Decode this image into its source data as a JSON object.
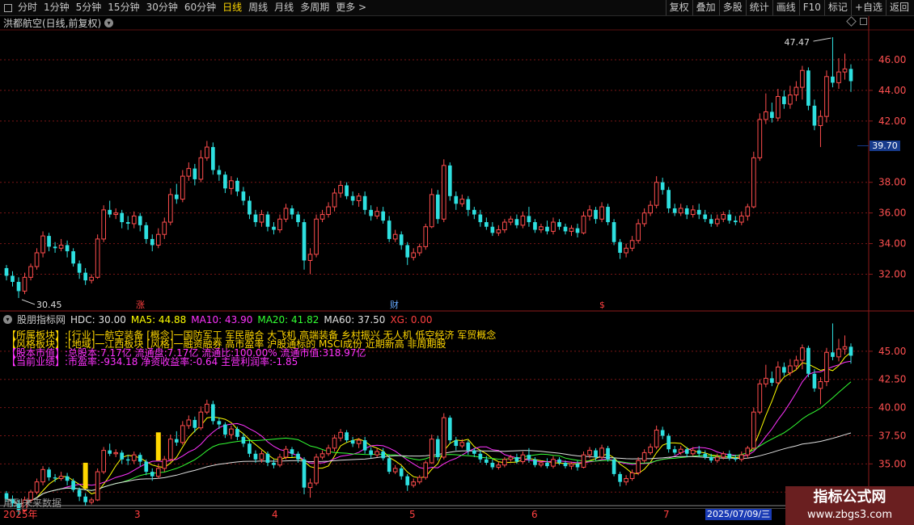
{
  "toolbar": {
    "periods": [
      "分时",
      "1分钟",
      "5分钟",
      "15分钟",
      "30分钟",
      "60分钟",
      "日线",
      "周线",
      "月线",
      "多周期",
      "更多 >"
    ],
    "active_period": "日线",
    "right_buttons": [
      "复权",
      "叠加",
      "多股",
      "统计",
      "画线",
      "F10",
      "标记",
      "+自选",
      "返回"
    ]
  },
  "main_chart": {
    "title": "洪都航空(日线,前复权)",
    "yaxis_ticks": [
      "46.00",
      "44.00",
      "42.00",
      "38.00",
      "36.00",
      "34.00",
      "32.00"
    ],
    "high_label": "47.47",
    "low_label": "30.45",
    "current_price": "39.70",
    "badges": {
      "zhang": "涨",
      "cai": "财",
      "s": "$"
    },
    "colors": {
      "up": "#ff4d4d",
      "down": "#2ee0e0",
      "grid": "#7a1616",
      "axis": "#8b1a1a"
    }
  },
  "indicator": {
    "title": "股朋指标网",
    "values": {
      "hdc": "HDC: 30.00",
      "ma5": "MA5: 44.88",
      "ma10": "MA10: 43.90",
      "ma20": "MA20: 41.82",
      "ma60": "MA60: 37.50",
      "xg": "XG: 0.00"
    },
    "info_rows": [
      {
        "label": "【所属板块】:",
        "text": "[行业]一航空装备 [概念]一国防军工 军民融合 大飞机 高端装备 乡村振兴 无人机 低空经济 军贸概念"
      },
      {
        "label": "【风格板块】:",
        "text": "[地域]一江西板块 [风格]一融资融券 高市盈率 沪股通标的 MSCI成份 近期新高 非周期股"
      },
      {
        "label": "【股本市值】:",
        "text": "总股本:7.17亿 流通盘:7.17亿 流通比:100.00% 流通市值:318.97亿"
      },
      {
        "label": "【当前业绩】:",
        "text": "市盈率:-934.18 净资收益率:-0.64 主营利润率:-1.85"
      }
    ],
    "yaxis_ticks": [
      "45.00",
      "42.50",
      "40.00",
      "37.50",
      "35.00",
      "32.50"
    ],
    "ghost_text": "用到未来数据"
  },
  "date_axis": {
    "labels": [
      "2025年",
      "3",
      "4",
      "5",
      "6",
      "7"
    ],
    "cursor_date": "2025/07/09/三"
  },
  "watermark": {
    "line1": "指标公式网",
    "line2": "www.zbgs3.com"
  },
  "chart_data": {
    "type": "candlestick",
    "ylim_main": [
      30.5,
      48.0
    ],
    "ylim_indicator": [
      32.3,
      47.5
    ],
    "candles": [
      [
        32.4,
        31.9,
        32.6,
        31.6
      ],
      [
        31.9,
        31.5,
        32.2,
        31.2
      ],
      [
        31.5,
        30.9,
        31.8,
        30.45
      ],
      [
        30.9,
        31.8,
        32.1,
        30.7
      ],
      [
        31.8,
        32.5,
        32.7,
        31.6
      ],
      [
        32.5,
        33.4,
        33.7,
        32.3
      ],
      [
        33.4,
        34.5,
        34.8,
        33.1
      ],
      [
        34.5,
        33.8,
        34.7,
        33.5
      ],
      [
        33.8,
        33.7,
        34.1,
        33.4
      ],
      [
        33.7,
        33.9,
        34.3,
        33.5
      ],
      [
        33.9,
        33.5,
        34.2,
        33.1
      ],
      [
        33.5,
        32.7,
        33.7,
        32.5
      ],
      [
        32.7,
        32.1,
        32.9,
        31.7
      ],
      [
        32.1,
        31.6,
        32.4,
        31.3
      ],
      [
        31.6,
        31.8,
        32.0,
        31.4
      ],
      [
        31.8,
        34.3,
        34.6,
        31.7
      ],
      [
        34.3,
        36.2,
        36.5,
        34.1
      ],
      [
        36.2,
        35.9,
        36.8,
        35.7
      ],
      [
        35.9,
        36.0,
        36.3,
        35.6
      ],
      [
        36.0,
        35.4,
        36.2,
        35.0
      ],
      [
        35.4,
        35.3,
        35.8,
        34.9
      ],
      [
        35.3,
        35.8,
        36.1,
        35.0
      ],
      [
        35.8,
        35.2,
        36.0,
        34.8
      ],
      [
        35.2,
        34.3,
        35.4,
        34.0
      ],
      [
        34.3,
        33.9,
        34.6,
        33.5
      ],
      [
        33.9,
        34.6,
        35.0,
        33.7
      ],
      [
        34.6,
        35.4,
        35.7,
        34.3
      ],
      [
        35.4,
        37.2,
        37.6,
        35.2
      ],
      [
        37.2,
        36.9,
        37.9,
        36.6
      ],
      [
        36.9,
        38.4,
        38.8,
        36.7
      ],
      [
        38.4,
        38.9,
        39.3,
        38.1
      ],
      [
        38.9,
        38.2,
        39.2,
        37.8
      ],
      [
        38.2,
        39.6,
        40.1,
        38.0
      ],
      [
        39.6,
        40.3,
        40.7,
        39.4
      ],
      [
        40.3,
        38.8,
        40.6,
        38.5
      ],
      [
        38.8,
        38.5,
        39.1,
        38.1
      ],
      [
        38.5,
        37.6,
        38.7,
        37.3
      ],
      [
        37.6,
        38.1,
        38.4,
        37.2
      ],
      [
        38.1,
        37.4,
        38.3,
        37.1
      ],
      [
        37.4,
        36.8,
        37.7,
        36.5
      ],
      [
        36.8,
        35.9,
        37.1,
        35.6
      ],
      [
        35.9,
        35.4,
        36.2,
        35.1
      ],
      [
        35.4,
        35.9,
        36.2,
        35.1
      ],
      [
        35.9,
        35.1,
        36.1,
        34.8
      ],
      [
        35.1,
        34.9,
        35.4,
        34.6
      ],
      [
        34.9,
        35.6,
        35.9,
        34.7
      ],
      [
        35.6,
        36.3,
        36.6,
        35.4
      ],
      [
        36.3,
        35.9,
        36.5,
        35.6
      ],
      [
        35.9,
        35.4,
        36.1,
        35.1
      ],
      [
        35.4,
        32.9,
        35.6,
        32.3
      ],
      [
        32.9,
        33.3,
        33.7,
        32.0
      ],
      [
        33.3,
        35.6,
        35.9,
        33.1
      ],
      [
        35.6,
        35.9,
        36.2,
        35.4
      ],
      [
        35.9,
        36.4,
        36.7,
        35.7
      ],
      [
        36.4,
        37.3,
        37.6,
        36.1
      ],
      [
        37.3,
        37.8,
        38.1,
        37.0
      ],
      [
        37.8,
        37.1,
        38.0,
        36.9
      ],
      [
        37.1,
        36.8,
        37.4,
        36.5
      ],
      [
        36.8,
        37.1,
        37.3,
        36.4
      ],
      [
        37.1,
        36.2,
        37.4,
        35.9
      ],
      [
        36.2,
        35.8,
        36.5,
        35.5
      ],
      [
        35.8,
        36.1,
        36.4,
        35.6
      ],
      [
        36.1,
        35.5,
        36.4,
        35.3
      ],
      [
        35.5,
        34.3,
        35.8,
        34.1
      ],
      [
        34.3,
        34.6,
        34.9,
        34.1
      ],
      [
        34.6,
        33.9,
        34.8,
        33.6
      ],
      [
        33.9,
        33.1,
        34.1,
        32.6
      ],
      [
        33.1,
        33.4,
        33.7,
        32.9
      ],
      [
        33.4,
        33.8,
        34.0,
        33.2
      ],
      [
        33.8,
        35.1,
        35.3,
        33.6
      ],
      [
        35.1,
        37.2,
        37.6,
        35.0
      ],
      [
        37.2,
        35.6,
        37.5,
        35.3
      ],
      [
        35.6,
        39.1,
        39.5,
        35.4
      ],
      [
        39.1,
        37.1,
        39.3,
        36.8
      ],
      [
        37.1,
        36.6,
        37.4,
        36.2
      ],
      [
        36.6,
        36.9,
        37.2,
        36.4
      ],
      [
        36.9,
        36.2,
        37.1,
        35.8
      ],
      [
        36.2,
        35.9,
        36.4,
        35.6
      ],
      [
        35.9,
        35.4,
        36.2,
        35.1
      ],
      [
        35.4,
        35.1,
        35.7,
        34.9
      ],
      [
        35.1,
        34.7,
        35.4,
        34.5
      ],
      [
        34.7,
        34.9,
        35.2,
        34.5
      ],
      [
        34.9,
        35.4,
        35.6,
        34.7
      ],
      [
        35.4,
        35.6,
        35.8,
        35.2
      ],
      [
        35.6,
        35.2,
        35.9,
        35.0
      ],
      [
        35.2,
        35.8,
        36.1,
        35.0
      ],
      [
        35.8,
        35.4,
        36.4,
        35.1
      ],
      [
        35.4,
        34.9,
        35.6,
        34.7
      ],
      [
        34.9,
        35.1,
        35.3,
        34.7
      ],
      [
        35.1,
        34.8,
        35.5,
        34.6
      ],
      [
        34.8,
        35.4,
        35.7,
        34.6
      ],
      [
        35.4,
        35.1,
        35.6,
        34.9
      ],
      [
        35.1,
        34.8,
        35.3,
        34.6
      ],
      [
        34.8,
        35.0,
        35.2,
        34.5
      ],
      [
        35.0,
        34.7,
        35.3,
        34.4
      ],
      [
        34.7,
        35.8,
        36.1,
        34.6
      ],
      [
        35.8,
        36.2,
        36.5,
        35.5
      ],
      [
        36.2,
        35.6,
        36.4,
        35.3
      ],
      [
        35.6,
        36.4,
        36.7,
        35.4
      ],
      [
        36.4,
        35.4,
        36.6,
        35.2
      ],
      [
        35.4,
        34.1,
        35.6,
        33.9
      ],
      [
        34.1,
        33.4,
        34.3,
        33.0
      ],
      [
        33.4,
        33.7,
        34.0,
        33.1
      ],
      [
        33.7,
        34.2,
        34.5,
        33.5
      ],
      [
        34.2,
        35.3,
        35.6,
        34.0
      ],
      [
        35.3,
        36.0,
        36.3,
        35.1
      ],
      [
        36.0,
        36.5,
        36.8,
        35.8
      ],
      [
        36.5,
        38.0,
        38.4,
        36.3
      ],
      [
        38.0,
        37.5,
        38.3,
        37.2
      ],
      [
        37.5,
        36.3,
        37.7,
        36.0
      ],
      [
        36.3,
        36.0,
        36.6,
        35.8
      ],
      [
        36.0,
        36.3,
        36.6,
        35.8
      ],
      [
        36.3,
        35.9,
        36.5,
        35.6
      ],
      [
        35.9,
        36.2,
        36.5,
        35.7
      ],
      [
        36.2,
        35.9,
        36.6,
        35.6
      ],
      [
        35.9,
        35.6,
        36.2,
        35.4
      ],
      [
        35.6,
        35.3,
        35.9,
        35.1
      ],
      [
        35.3,
        35.6,
        35.9,
        35.1
      ],
      [
        35.6,
        35.9,
        36.1,
        35.4
      ],
      [
        35.9,
        35.5,
        36.2,
        35.3
      ],
      [
        35.5,
        35.4,
        35.8,
        35.2
      ],
      [
        35.4,
        35.8,
        36.1,
        35.2
      ],
      [
        35.8,
        36.4,
        36.6,
        35.5
      ],
      [
        36.4,
        39.6,
        40.0,
        36.3
      ],
      [
        39.6,
        42.1,
        42.5,
        39.4
      ],
      [
        42.1,
        42.6,
        43.8,
        41.8
      ],
      [
        42.6,
        42.2,
        43.2,
        41.9
      ],
      [
        42.2,
        43.6,
        44.1,
        42.0
      ],
      [
        43.6,
        43.1,
        44.0,
        42.8
      ],
      [
        43.1,
        43.7,
        44.3,
        42.8
      ],
      [
        43.7,
        44.2,
        44.6,
        43.3
      ],
      [
        44.2,
        45.3,
        45.6,
        43.4
      ],
      [
        45.3,
        43.0,
        45.5,
        42.7
      ],
      [
        43.0,
        41.7,
        43.4,
        41.4
      ],
      [
        41.7,
        42.3,
        42.7,
        40.3
      ],
      [
        42.3,
        44.9,
        45.3,
        41.9
      ],
      [
        44.9,
        44.5,
        47.47,
        44.2
      ],
      [
        44.5,
        45.2,
        46.1,
        44.1
      ],
      [
        45.2,
        45.4,
        46.4,
        44.7
      ],
      [
        45.4,
        44.6,
        45.7,
        43.9
      ]
    ],
    "ma_colors": {
      "hdc": "#e0e0e0",
      "ma5": "#ffff00",
      "ma10": "#ff33ff",
      "ma20": "#33ff33",
      "ma60": "#e0e0e0",
      "xg": "#ff4040"
    },
    "signal_bars": [
      {
        "index": 13,
        "low": 32.8,
        "high": 35.1
      },
      {
        "index": 25,
        "low": 35.3,
        "high": 37.8
      }
    ]
  }
}
